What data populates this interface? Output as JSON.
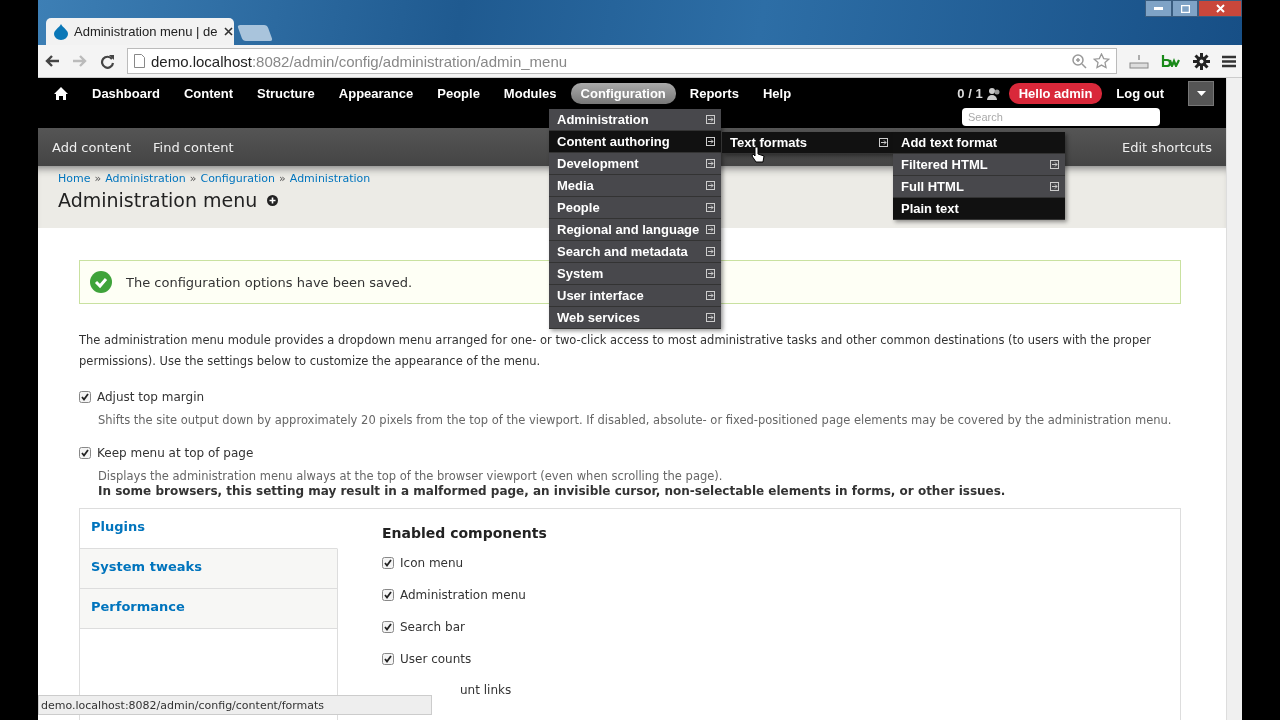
{
  "browser": {
    "tab_title": "Administration menu | de",
    "url_host": "demo.localhost",
    "url_path": ":8082/admin/config/administration/admin_menu"
  },
  "admin_bar": {
    "items": [
      {
        "label": "Dashboard",
        "selected": false
      },
      {
        "label": "Content",
        "selected": false
      },
      {
        "label": "Structure",
        "selected": false
      },
      {
        "label": "Appearance",
        "selected": false
      },
      {
        "label": "People",
        "selected": false
      },
      {
        "label": "Modules",
        "selected": false
      },
      {
        "label": "Configuration",
        "selected": true
      },
      {
        "label": "Reports",
        "selected": false
      },
      {
        "label": "Help",
        "selected": false
      }
    ],
    "user_count": "0 / 1",
    "greeting": "Hello admin",
    "logout": "Log out",
    "search": {
      "placeholder": "Search"
    }
  },
  "menu": {
    "items": [
      {
        "label": "Administration",
        "selected": false
      },
      {
        "label": "Content authoring",
        "selected": true
      },
      {
        "label": "Development",
        "selected": false
      },
      {
        "label": "Media",
        "selected": false
      },
      {
        "label": "People",
        "selected": false
      },
      {
        "label": "Regional and language",
        "selected": false
      },
      {
        "label": "Search and metadata",
        "selected": false
      },
      {
        "label": "System",
        "selected": false
      },
      {
        "label": "User interface",
        "selected": false
      },
      {
        "label": "Web services",
        "selected": false
      }
    ],
    "submenu": [
      {
        "label": "Text formats",
        "selected": true
      }
    ],
    "subsubmenu": [
      {
        "label": "Add text format",
        "highlighted": true,
        "has_children": false
      },
      {
        "label": "Filtered HTML",
        "highlighted": false,
        "has_children": true
      },
      {
        "label": "Full HTML",
        "highlighted": false,
        "has_children": true
      },
      {
        "label": "Plain text",
        "highlighted": true,
        "has_children": false
      }
    ]
  },
  "shortcuts": {
    "items": [
      "Add content",
      "Find content"
    ],
    "edit": "Edit shortcuts"
  },
  "breadcrumb": [
    {
      "label": "Home",
      "separator": "»"
    },
    {
      "label": "Administration",
      "separator": "»"
    },
    {
      "label": "Configuration",
      "separator": "»"
    },
    {
      "label": "Administration"
    }
  ],
  "page_title": "Administration menu",
  "message": "The configuration options have been saved.",
  "intro": "The administration menu module provides a dropdown menu arranged for one- or two-click access to most administrative tasks and other common destinations (to users with the proper permissions). Use the settings below to customize the appearance of the menu.",
  "options": [
    {
      "label": "Adjust top margin",
      "checked": true,
      "description": "Shifts the site output down by approximately 20 pixels from the top of the viewport. If disabled, absolute- or fixed-positioned page elements may be covered by the administration menu."
    },
    {
      "label": "Keep menu at top of page",
      "checked": true,
      "description": "Displays the administration menu always at the top of the browser viewport (even when scrolling the page).",
      "warning": "In some browsers, this setting may result in a malformed page, an invisible cursor, non-selectable elements in forms, or other issues."
    }
  ],
  "vertical_tabs": [
    {
      "label": "Plugins",
      "selected": true
    },
    {
      "label": "System tweaks",
      "selected": false
    },
    {
      "label": "Performance",
      "selected": false
    }
  ],
  "section_title": "Enabled components",
  "components": [
    {
      "label": "Icon menu",
      "checked": true
    },
    {
      "label": "Administration menu",
      "checked": true
    },
    {
      "label": "Search bar",
      "checked": true
    },
    {
      "label": "User counts",
      "checked": true
    }
  ],
  "hidden_component_label": "unt links",
  "status_bar": "demo.localhost:8082/admin/config/content/formats"
}
